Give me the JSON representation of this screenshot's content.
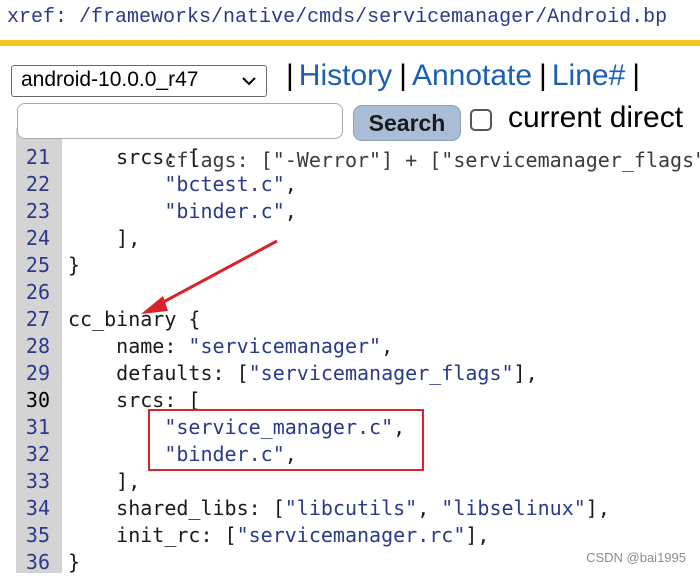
{
  "header": {
    "prefix": "xref:",
    "path": "/frameworks/native/cmds/servicemanager/Android.bp"
  },
  "toolbar": {
    "version": "android-10.0.0_r47",
    "nav_links": [
      "History",
      "Annotate",
      "Line#"
    ],
    "search_label": "Search",
    "directory_label": "current direct"
  },
  "code": {
    "hidden_line": "        cflags: [\"-Werror\"] + [\"servicemanager_flags\"],",
    "lines": [
      {
        "num": "21",
        "text": "    srcs: ["
      },
      {
        "num": "22",
        "pre": "        ",
        "str": "\"bctest.c\"",
        "post": ","
      },
      {
        "num": "23",
        "pre": "        ",
        "str": "\"binder.c\"",
        "post": ","
      },
      {
        "num": "24",
        "text": "    ],"
      },
      {
        "num": "25",
        "text": "}"
      },
      {
        "num": "26",
        "text": ""
      },
      {
        "num": "27",
        "text": "cc_binary {"
      },
      {
        "num": "28",
        "pre": "    name: ",
        "str": "\"servicemanager\"",
        "post": ","
      },
      {
        "num": "29",
        "pre": "    defaults: [",
        "str": "\"servicemanager_flags\"",
        "post": "],"
      },
      {
        "num": "30",
        "text": "    srcs: [",
        "current": true
      },
      {
        "num": "31",
        "pre": "        ",
        "str": "\"service_manager.c\"",
        "post": ","
      },
      {
        "num": "32",
        "pre": "        ",
        "str": "\"binder.c\"",
        "post": ","
      },
      {
        "num": "33",
        "text": "    ],"
      },
      {
        "num": "34",
        "pre": "    shared_libs: [",
        "str": "\"libcutils\"",
        "mid": ", ",
        "str2": "\"libselinux\"",
        "post": "],"
      },
      {
        "num": "35",
        "pre": "    init_rc: [",
        "str": "\"servicemanager.rc\"",
        "post": "],"
      },
      {
        "num": "36",
        "text": "}"
      }
    ]
  },
  "watermark": "CSDN @bai1995",
  "colors": {
    "accent_rule": "#f5c425",
    "link": "#1a5fb4",
    "string": "#2a3a8a",
    "annotation": "#d8232a",
    "gutter": "#d4d4d4",
    "search_button": "#a9bdd6"
  }
}
